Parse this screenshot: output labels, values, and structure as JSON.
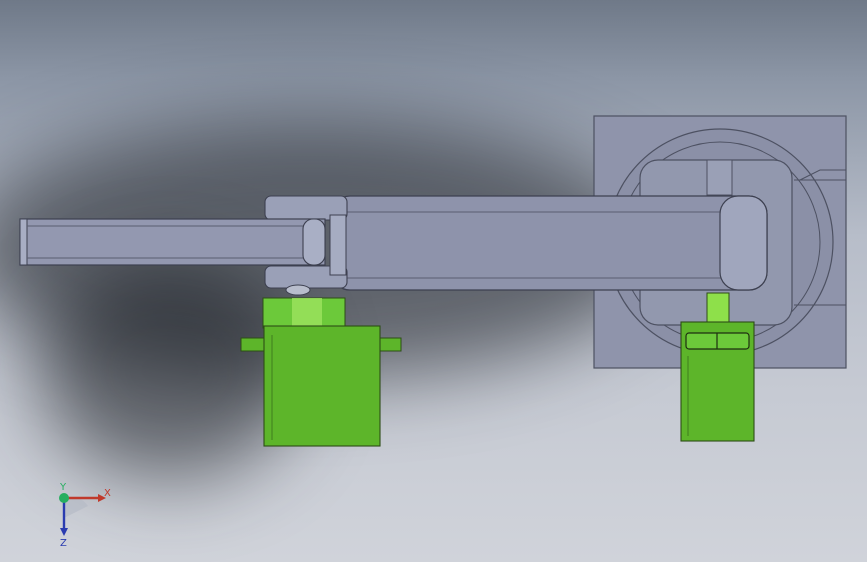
{
  "viewport": {
    "triad": {
      "x_label": "X",
      "y_label": "Y",
      "z_label": "Z",
      "x_color": "#c0392b",
      "y_color": "#27ae60",
      "z_color": "#2a3bb0"
    }
  },
  "colors": {
    "part_gray": "#8e93ab",
    "part_gray_dark": "#5a5e70",
    "servo_green": "#5db52a",
    "servo_green_light": "#8ee04a"
  }
}
